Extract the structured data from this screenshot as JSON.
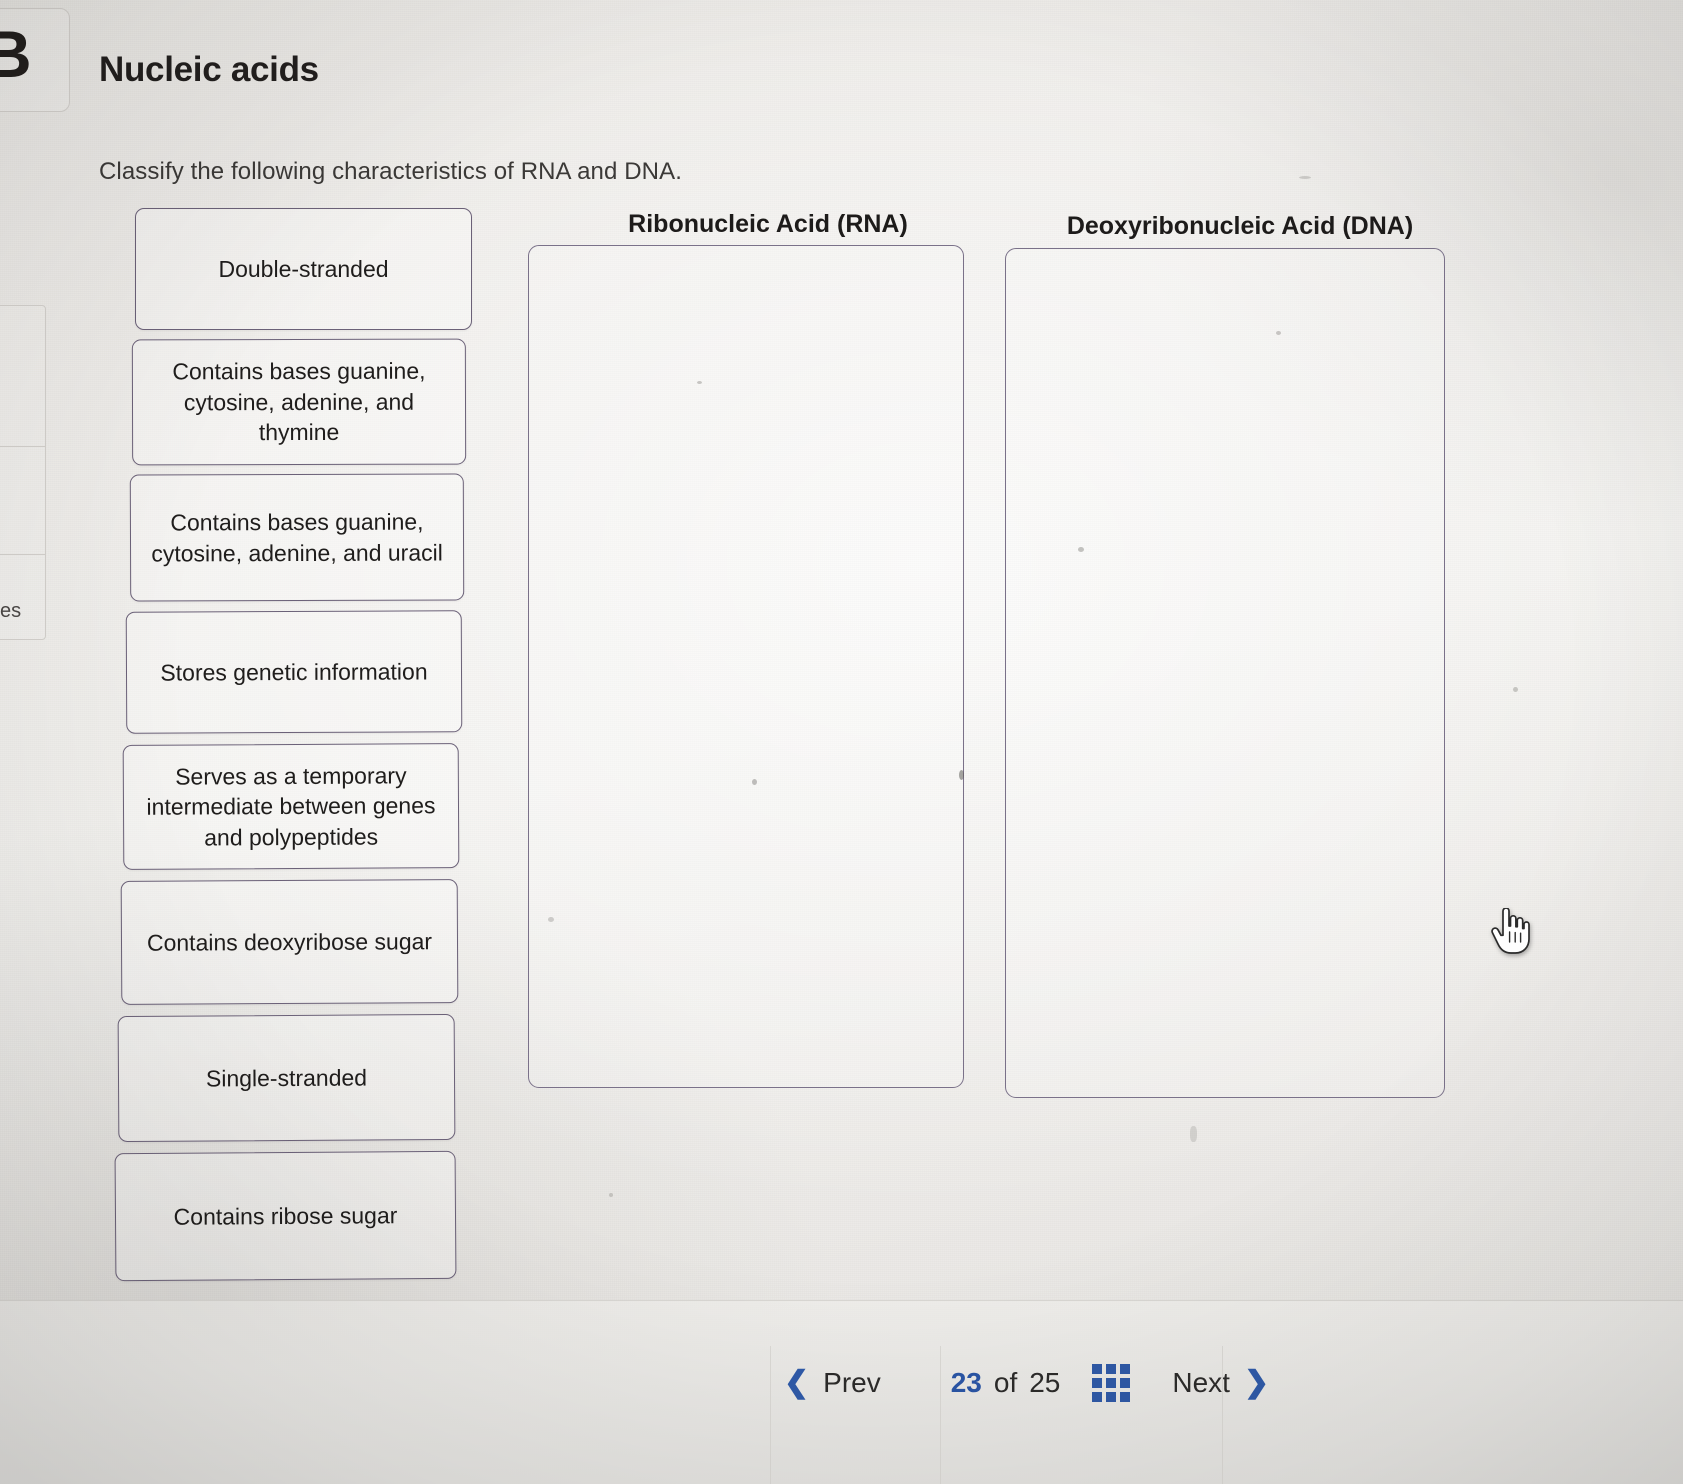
{
  "window": {
    "cropped_left_glyph": "B",
    "cropped_sidebar_label": "es"
  },
  "header": {
    "title": "Nucleic acids",
    "instruction": "Classify the following characteristics of RNA and DNA."
  },
  "tiles": [
    {
      "label": "Double-stranded"
    },
    {
      "label": "Contains bases guanine, cytosine, adenine, and thymine"
    },
    {
      "label": "Contains bases guanine, cytosine, adenine, and uracil"
    },
    {
      "label": "Stores genetic information"
    },
    {
      "label": "Serves as a temporary intermediate between genes and polypeptides"
    },
    {
      "label": "Contains deoxyribose sugar"
    },
    {
      "label": "Single-stranded"
    },
    {
      "label": "Contains ribose sugar"
    }
  ],
  "dropzones": [
    {
      "title": "Ribonucleic Acid (RNA)",
      "items": []
    },
    {
      "title": "Deoxyribonucleic Acid (DNA)",
      "items": []
    }
  ],
  "navigation": {
    "prev_label": "Prev",
    "next_label": "Next",
    "prev_icon": "chevron-left-icon",
    "next_icon": "chevron-right-icon",
    "grid_icon": "grid-menu-icon",
    "current_page": "23",
    "of_label": "of",
    "total_pages": "25"
  },
  "cursor": {
    "icon": "pointing-hand-cursor"
  },
  "colors": {
    "accent_blue": "#2f59a6",
    "tile_border": "#6b6178",
    "dropzone_border": "#7a7189",
    "text": "#1f1d1c",
    "background": "#efedea"
  }
}
